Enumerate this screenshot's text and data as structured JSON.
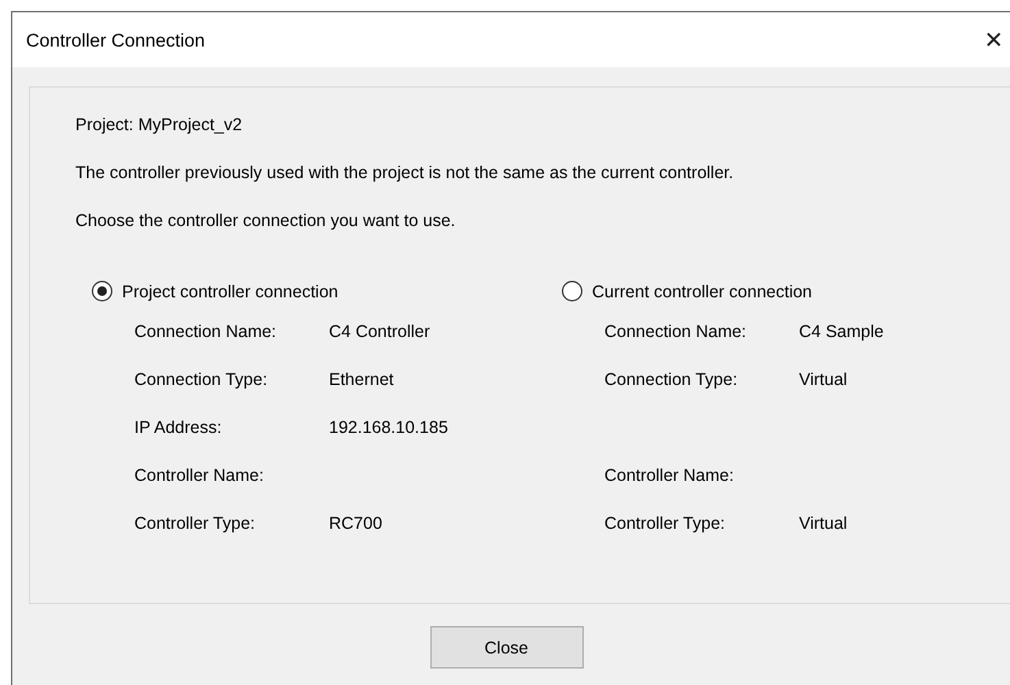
{
  "window": {
    "title": "Controller Connection",
    "close_glyph": "✕"
  },
  "project_line": "Project: MyProject_v2",
  "message": "The controller previously used with the project is not the same as the current controller.",
  "prompt": "Choose the controller connection you want to use.",
  "options": [
    {
      "label": "Project controller connection",
      "selected": true
    },
    {
      "label": "Current controller connection",
      "selected": false
    }
  ],
  "rows": [
    {
      "project": {
        "label": "Connection Name:",
        "value": "C4 Controller"
      },
      "current": {
        "label": "Connection Name:",
        "value": "C4 Sample"
      }
    },
    {
      "project": {
        "label": "Connection Type:",
        "value": "Ethernet"
      },
      "current": {
        "label": "Connection Type:",
        "value": "Virtual"
      }
    },
    {
      "project": {
        "label": "IP Address:",
        "value": "192.168.10.185"
      }
    },
    {
      "project": {
        "label": "Controller Name:"
      },
      "current": {
        "label": "Controller Name:"
      }
    },
    {
      "project": {
        "label": "Controller Type:",
        "value": "RC700"
      },
      "current": {
        "label": "Controller Type:",
        "value": "Virtual"
      }
    }
  ],
  "buttons": [
    {
      "label": "Close"
    }
  ]
}
